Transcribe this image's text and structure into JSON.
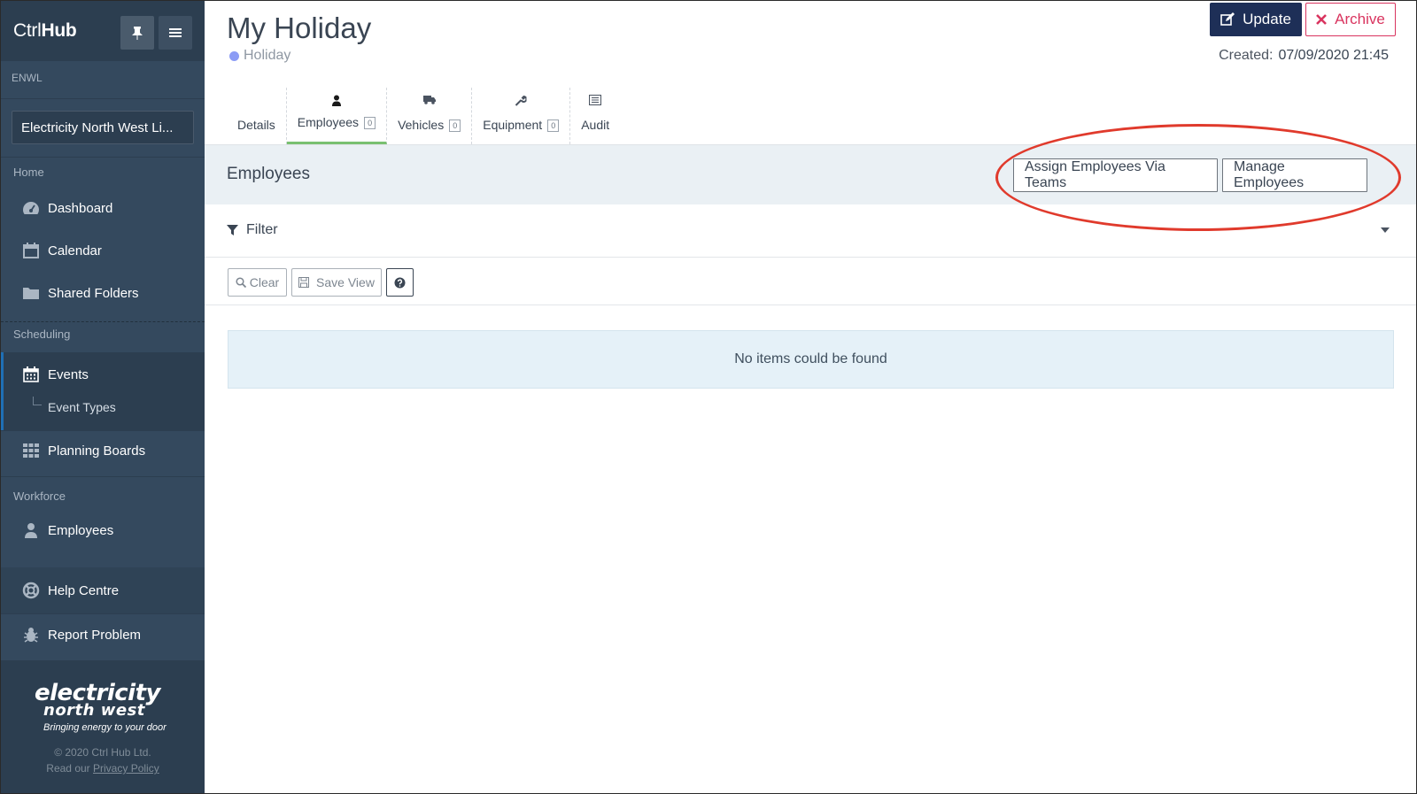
{
  "app": {
    "brand_light": "Ctrl",
    "brand_bold": "Hub"
  },
  "sidebar": {
    "org_heading": "ENWL",
    "org_name": "Electricity North West Li...",
    "sections": {
      "home": "Home",
      "scheduling": "Scheduling",
      "workforce": "Workforce"
    },
    "items": {
      "dashboard": "Dashboard",
      "calendar": "Calendar",
      "shared_folders": "Shared Folders",
      "events": "Events",
      "event_types": "Event Types",
      "planning_boards": "Planning Boards",
      "employees": "Employees",
      "help_centre": "Help Centre",
      "report_problem": "Report Problem"
    },
    "logo": {
      "line1": "electricity",
      "line2": "north west",
      "tagline": "Bringing energy to your door"
    },
    "copyright": "© 2020 Ctrl Hub Ltd.",
    "privacy_prefix": "Read our",
    "privacy_link": "Privacy Policy"
  },
  "page": {
    "title": "My Holiday",
    "subtitle": "Holiday",
    "update_label": "Update",
    "archive_label": "Archive",
    "created_label": "Created:",
    "created_value": "07/09/2020 21:45"
  },
  "tabs": [
    {
      "label": "Details",
      "count": null
    },
    {
      "label": "Employees",
      "count": "0"
    },
    {
      "label": "Vehicles",
      "count": "0"
    },
    {
      "label": "Equipment",
      "count": "0"
    },
    {
      "label": "Audit",
      "count": null
    }
  ],
  "section": {
    "title": "Employees",
    "assign_label": "Assign Employees Via Teams",
    "manage_label": "Manage Employees"
  },
  "filter": {
    "label": "Filter"
  },
  "toolbar": {
    "clear_label": "Clear",
    "save_view_label": "Save View"
  },
  "empty_message": "No items could be found",
  "colors": {
    "sidebar_bg": "#34495e",
    "sidebar_dark": "#2c3e50",
    "update_bg": "#1e2f57",
    "archive_accent": "#d9345f",
    "active_tab": "#79c070",
    "annotation_red": "#e03a2c",
    "subtitle_dot": "#8c9cf5"
  }
}
